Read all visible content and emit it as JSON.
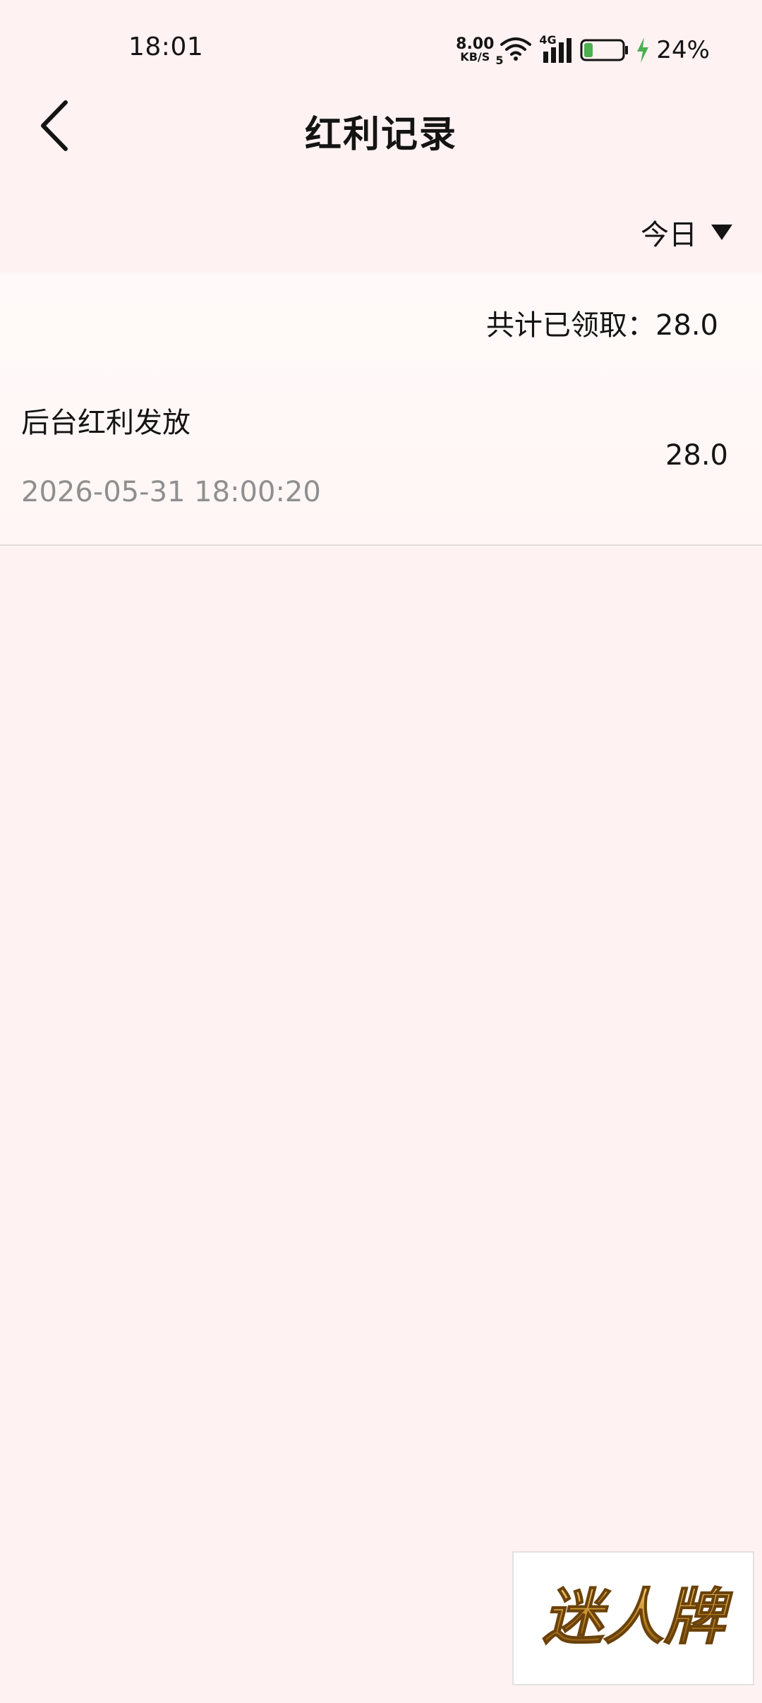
{
  "status_bar": {
    "time": "18:01",
    "net_speed_value": "8.00",
    "net_speed_unit": "KB/S",
    "wifi_sub_label": "5",
    "signal_label": "4G",
    "battery_percent": "24%",
    "battery_level": 0.24
  },
  "header": {
    "title": "红利记录",
    "back_icon": "chevron-left-icon"
  },
  "filter": {
    "selected": "今日",
    "icon": "triangle-down-icon"
  },
  "summary": {
    "label": "共计已领取：",
    "value": "28.0"
  },
  "records": [
    {
      "title": "后台红利发放",
      "time": "2026-05-31 18:00:20",
      "amount": "28.0"
    }
  ],
  "brand_badge": {
    "text": "迷人牌"
  },
  "colors": {
    "background": "#fff2f2",
    "text": "#141414",
    "muted_text": "#8f8f8f",
    "battery_fill": "#4caf50",
    "charging_bolt": "#4caf50",
    "brand_gold": "#b8860b"
  }
}
